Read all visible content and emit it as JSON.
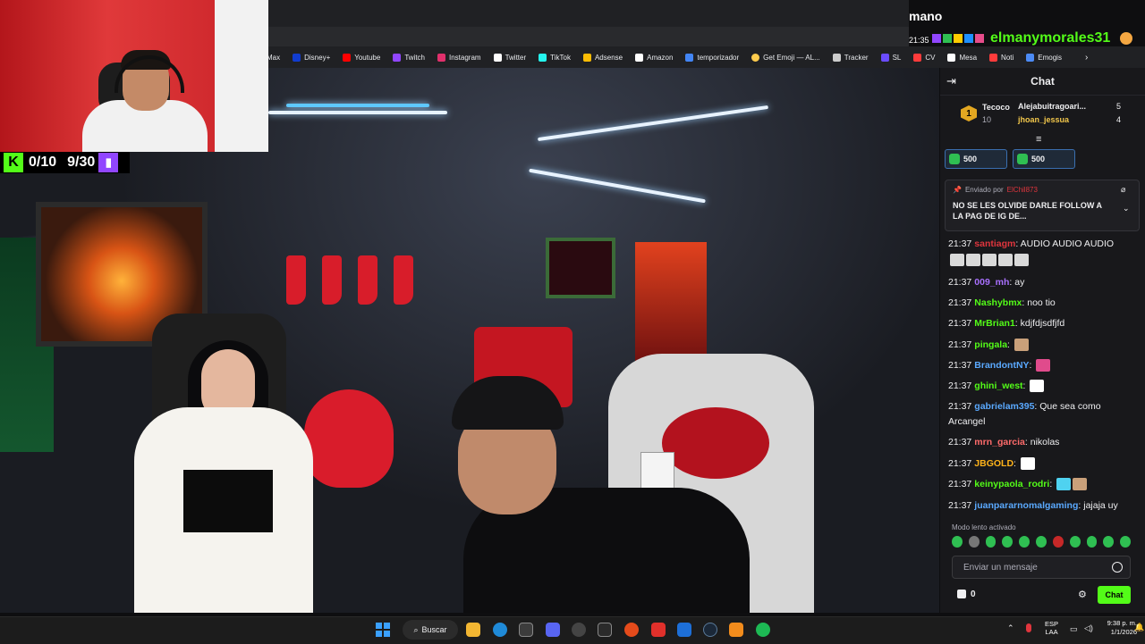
{
  "overlay": {
    "channel": "mano",
    "time": "21:35",
    "username": "elmanymorales31",
    "counter_kick": "0/10",
    "counter_twitch": "9/30"
  },
  "bookmarks": [
    {
      "label": "Max",
      "color": "#0a3cff"
    },
    {
      "label": "Disney+",
      "color": "#113ccf"
    },
    {
      "label": "Youtube",
      "color": "#ff0000"
    },
    {
      "label": "Twitch",
      "color": "#9146ff"
    },
    {
      "label": "Instagram",
      "color": "#e1306c"
    },
    {
      "label": "Twitter",
      "color": "#ffffff"
    },
    {
      "label": "TikTok",
      "color": "#25f4ee"
    },
    {
      "label": "Adsense",
      "color": "#fbbc04"
    },
    {
      "label": "Amazon",
      "color": "#ffffff"
    },
    {
      "label": "temporizador",
      "color": "#4285f4"
    },
    {
      "label": "Get Emoji — AL...",
      "color": "#ffcc4d"
    },
    {
      "label": "Tracker",
      "color": "#cccccc"
    },
    {
      "label": "SL",
      "color": "#6a4cff"
    },
    {
      "label": "CV",
      "color": "#ff3b3b"
    },
    {
      "label": "Mesa",
      "color": "#ffffff"
    },
    {
      "label": "Noti",
      "color": "#ff3b3b"
    },
    {
      "label": "Emogis",
      "color": "#4c8bf5"
    }
  ],
  "chat": {
    "header": "Chat",
    "leaderboard": {
      "rank": "1",
      "top_name": "Tecoco",
      "top_value": "10",
      "entries": [
        {
          "name": "Alejabuitragoari...",
          "value": "5"
        },
        {
          "name": "jhoan_jessua",
          "value": "4"
        }
      ]
    },
    "bits": [
      "500",
      "500"
    ],
    "pinned": {
      "sent_by": "Enviado por",
      "sender": "ElChil873",
      "text": "NO SE LES OLVIDE DARLE FOLLOW A LA PAG DE IG DE..."
    },
    "messages": [
      {
        "time": "21:37",
        "user": "santiagm",
        "color": "#e0353d",
        "text": "AUDIO AUDIO AUDIO",
        "emotes": 0
      },
      {
        "time": "",
        "user": "",
        "color": "#ffffff",
        "text": "",
        "emotes": 5
      },
      {
        "time": "21:37",
        "user": "009_mh",
        "color": "#a970ff",
        "text": "ay",
        "emotes": 0
      },
      {
        "time": "21:37",
        "user": "Nashybmx",
        "color": "#53fc18",
        "text": "noo tio",
        "emotes": 0
      },
      {
        "time": "21:37",
        "user": "MrBrian1",
        "color": "#53fc18",
        "text": "kdjfdjsdfjfd",
        "emotes": 0
      },
      {
        "time": "21:37",
        "user": "pingala",
        "color": "#53fc18",
        "text": "",
        "emotes": 1
      },
      {
        "time": "21:37",
        "user": "BrandontNY",
        "color": "#5aa9ff",
        "text": "",
        "emotes": 1
      },
      {
        "time": "21:37",
        "user": "ghini_west",
        "color": "#53fc18",
        "text": "",
        "emotes": 1
      },
      {
        "time": "21:37",
        "user": "gabrielam395",
        "color": "#5aa9ff",
        "text": "Que sea como",
        "emotes": 0
      },
      {
        "time": "",
        "user": "",
        "color": "#ffffff",
        "text": "Arcangel",
        "emotes": 0
      },
      {
        "time": "21:37",
        "user": "mrn_garcia",
        "color": "#ff6b6b",
        "text": "nikolas",
        "emotes": 0
      },
      {
        "time": "21:37",
        "user": "JBGOLD",
        "color": "#ffb31a",
        "text": "",
        "emotes": 1
      },
      {
        "time": "21:37",
        "user": "keinypaola_rodri",
        "color": "#53fc18",
        "text": "",
        "emotes": 2
      },
      {
        "time": "21:37",
        "user": "juanpararnomalgaming",
        "color": "#5aa9ff",
        "text": "jajaja uy",
        "emotes": 0
      }
    ],
    "slow_mode": "Modo lento activado",
    "input_placeholder": "Enviar un mensaje",
    "points": "0",
    "send_label": "Chat"
  },
  "taskbar": {
    "search": "Buscar",
    "lang_line1": "ESP",
    "lang_line2": "LAA",
    "time": "9:38 p. m.",
    "date": "1/1/2026"
  },
  "colors": {
    "kick_green": "#53fc18",
    "twitch_purple": "#9146ff",
    "chat_bg": "#18181b"
  }
}
